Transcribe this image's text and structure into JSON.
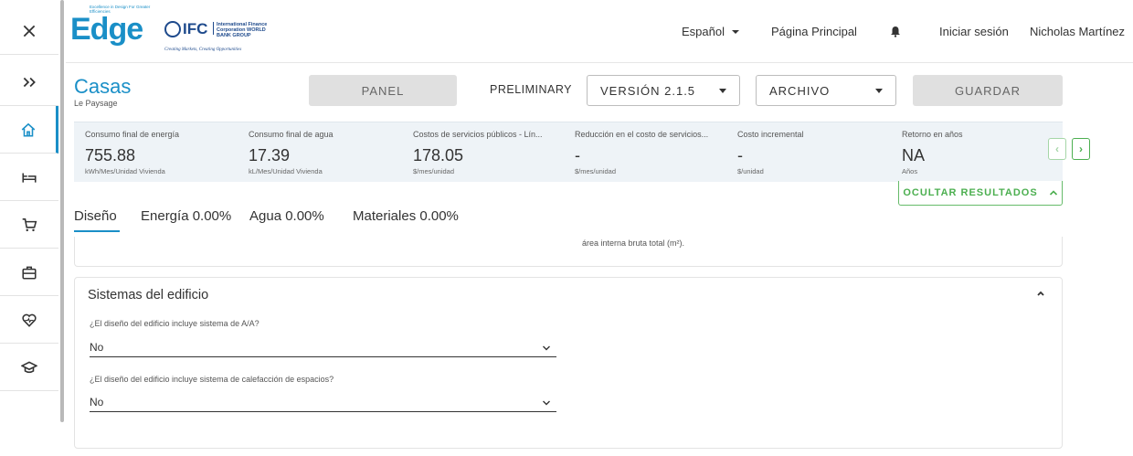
{
  "sidebar": {
    "items": [
      {
        "icon": "close-icon"
      },
      {
        "icon": "double-chevron-right-icon"
      },
      {
        "icon": "home-icon"
      },
      {
        "icon": "bed-icon"
      },
      {
        "icon": "cart-icon"
      },
      {
        "icon": "briefcase-icon"
      },
      {
        "icon": "heart-icon"
      },
      {
        "icon": "graduation-cap-icon"
      }
    ]
  },
  "header": {
    "logo_edge_tagline": "Excellence in Design For Greater Efficiencies",
    "logo_edge_word": "Edge",
    "logo_ifc_text": "IFC",
    "logo_ifc_name": "International Finance Corporation WORLD BANK GROUP",
    "logo_ifc_tagline": "Creating Markets, Creating Opportunities",
    "language": "Español",
    "home_link": "Página Principal",
    "login": "Iniciar sesión",
    "user_name": "Nicholas Martínez"
  },
  "project": {
    "title": "Casas",
    "subtitle": "Le Paysage",
    "panel_button": "PANEL",
    "status": "PRELIMINARY",
    "version": "VERSIÓN 2.1.5",
    "file_menu": "ARCHIVO",
    "save_button": "GUARDAR"
  },
  "results": {
    "metrics": [
      {
        "label": "Consumo final de energía",
        "value": "755.88",
        "unit": "kWh/Mes/Unidad Vivienda"
      },
      {
        "label": "Consumo final de agua",
        "value": "17.39",
        "unit": "kL/Mes/Unidad Vivienda"
      },
      {
        "label": "Costos de servicios públicos - Lín...",
        "value": "178.05",
        "unit": "$/mes/unidad"
      },
      {
        "label": "Reducción en el costo de servicios...",
        "value": "-",
        "unit": "$/mes/unidad"
      },
      {
        "label": "Costo incremental",
        "value": "-",
        "unit": "$/unidad"
      },
      {
        "label": "Retorno en años",
        "value": "NA",
        "unit": "Años"
      }
    ],
    "hide_button": "OCULTAR RESULTADOS"
  },
  "tabs": [
    {
      "label": "Diseño"
    },
    {
      "label": "Energía 0.00%"
    },
    {
      "label": "Agua 0.00%"
    },
    {
      "label": "Materiales 0.00%"
    }
  ],
  "content": {
    "partial_text": "área interna bruta total (m²).",
    "section_title": "Sistemas del edificio",
    "questions": [
      {
        "label": "¿El diseño del edificio incluye sistema de A/A?",
        "value": "No"
      },
      {
        "label": "¿El diseño del edificio incluye sistema de calefacción de espacios?",
        "value": "No"
      }
    ]
  },
  "colors": {
    "accent": "#1a8fc7",
    "success": "#4caf50",
    "results_bg": "#eef3f7"
  }
}
